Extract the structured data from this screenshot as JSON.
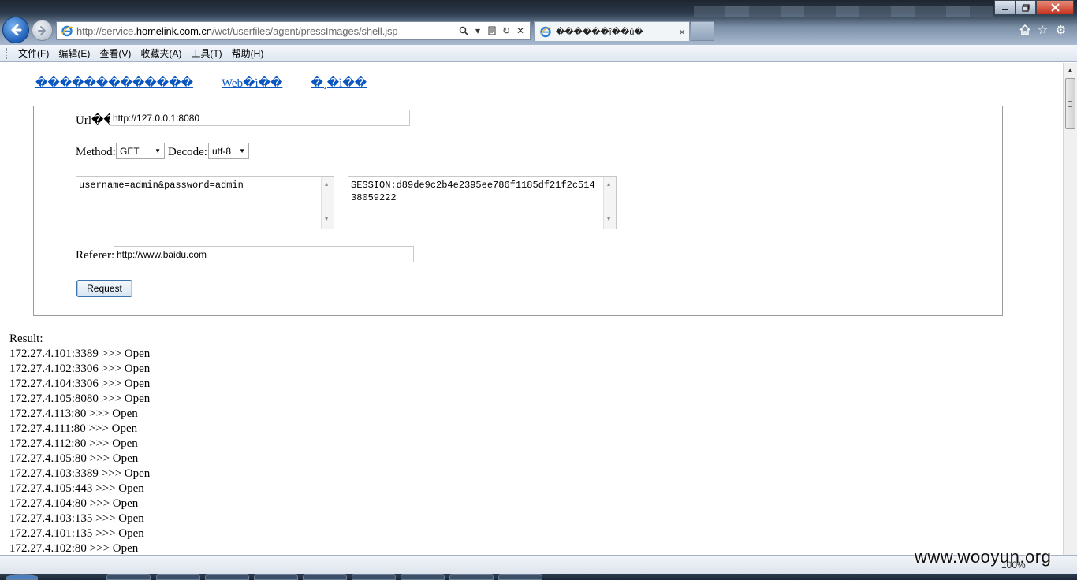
{
  "browser": {
    "address_url_prefix": "http://service.",
    "address_url_host": "homelink.com.cn",
    "address_url_path": "/wct/userfiles/agent/pressImages/shell.jsp",
    "tab_title": "������î��û�",
    "close_tab_glyph": "×",
    "zoom": "100%"
  },
  "menu": [
    "文件(F)",
    "编辑(E)",
    "查看(V)",
    "收藏夹(A)",
    "工具(T)",
    "帮助(H)"
  ],
  "page": {
    "links": [
      "�������������",
      "Web�ì��",
      "�¸�ì��"
    ],
    "url_label": "Url��",
    "url_value": "http://127.0.0.1:8080",
    "method_label": "Method:",
    "method_value": "GET",
    "decode_label": "Decode:",
    "decode_value": "utf-8",
    "post_data": "username=admin&password=admin",
    "cookie_data": "SESSION:d89de9c2b4e2395ee786f1185df21f2c51438059222",
    "referer_label": "Referer:",
    "referer_value": "http://www.baidu.com",
    "request_button": "Request",
    "result_label": "Result:",
    "results": [
      "172.27.4.101:3389 >>> Open",
      "172.27.4.102:3306 >>> Open",
      "172.27.4.104:3306 >>> Open",
      "172.27.4.105:8080 >>> Open",
      "172.27.4.113:80 >>> Open",
      "172.27.4.111:80 >>> Open",
      "172.27.4.112:80 >>> Open",
      "172.27.4.105:80 >>> Open",
      "172.27.4.103:3389 >>> Open",
      "172.27.4.105:443 >>> Open",
      "172.27.4.104:80 >>> Open",
      "172.27.4.103:135 >>> Open",
      "172.27.4.101:135 >>> Open",
      "172.27.4.102:80 >>> Open"
    ]
  },
  "watermark": "www.wooyun.org"
}
